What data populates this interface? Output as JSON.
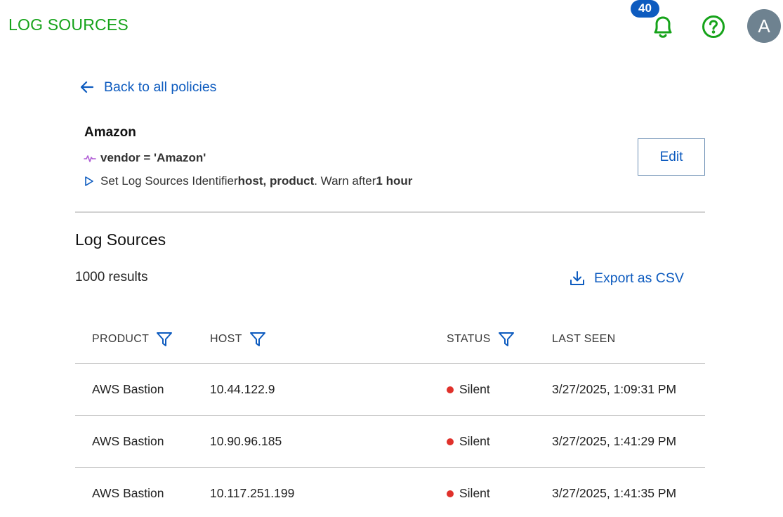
{
  "header": {
    "title": "LOG SOURCES",
    "notification_count": "40",
    "avatar_initial": "A",
    "icons": [
      "bell-icon",
      "help-icon"
    ],
    "accent_color": "#16a31a",
    "link_color": "#0d5bbf"
  },
  "back_link": {
    "label": "Back to all policies"
  },
  "policy": {
    "name": "Amazon",
    "condition": "vendor = 'Amazon'",
    "action_prefix": "Set Log Sources Identifier ",
    "action_fields": "host, product",
    "action_middle": ". Warn after ",
    "action_duration": "1 hour",
    "edit_label": "Edit"
  },
  "log_sources": {
    "title": "Log Sources",
    "result_count": "1000 results",
    "export_label": "Export as CSV",
    "columns": [
      "PRODUCT",
      "HOST",
      "STATUS",
      "LAST SEEN"
    ],
    "rows": [
      {
        "product": "AWS Bastion",
        "host": "10.44.122.9",
        "status": "Silent",
        "last_seen": "3/27/2025, 1:09:31 PM"
      },
      {
        "product": "AWS Bastion",
        "host": "10.90.96.185",
        "status": "Silent",
        "last_seen": "3/27/2025, 1:41:29 PM"
      },
      {
        "product": "AWS Bastion",
        "host": "10.117.251.199",
        "status": "Silent",
        "last_seen": "3/27/2025, 1:41:35 PM"
      }
    ],
    "status_color": "#e0312b"
  }
}
